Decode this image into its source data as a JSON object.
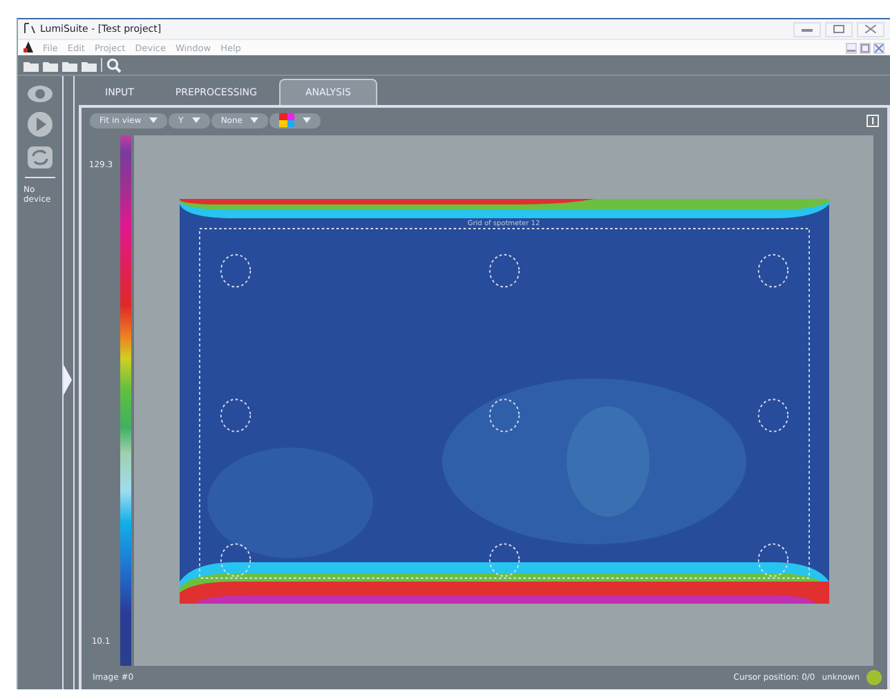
{
  "window": {
    "title": "LumiSuite - [Test project]"
  },
  "menu": [
    "File",
    "Edit",
    "Project",
    "Device",
    "Window",
    "Help"
  ],
  "sidebar": {
    "status": "No device"
  },
  "tabs": [
    {
      "label": "INPUT",
      "selected": false
    },
    {
      "label": "PREPROCESSING",
      "selected": false
    },
    {
      "label": "ANALYSIS",
      "selected": true
    }
  ],
  "view_toolbar": {
    "zoom": "Fit in view",
    "channel": "Y",
    "overlay": "None"
  },
  "colorbar": {
    "max": "129.3",
    "min": "10.1"
  },
  "image": {
    "grid_title": "Grid of spotmeter 12"
  },
  "status_bar": {
    "image": "Image #0",
    "cursor": "Cursor position: 0/0",
    "state": "unknown"
  }
}
